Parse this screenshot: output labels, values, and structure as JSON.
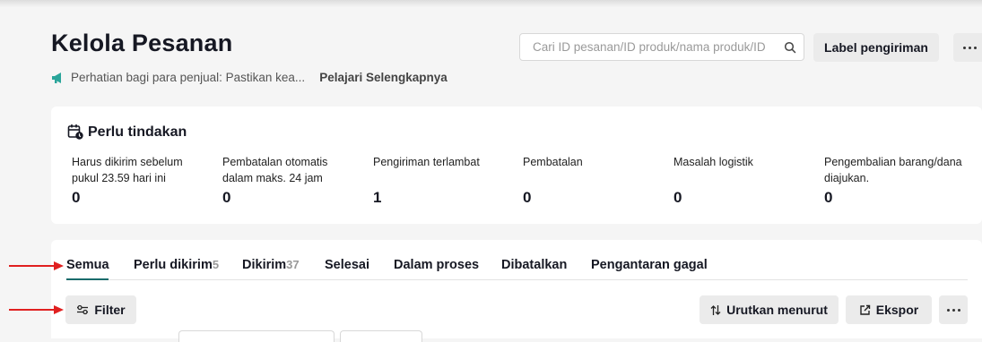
{
  "header": {
    "title": "Kelola Pesanan",
    "notice_text": "Perhatian bagi para penjual: Pastikan kea...",
    "notice_link": "Pelajari Selengkapnya",
    "search_placeholder": "Cari ID pesanan/ID produk/nama produk/ID",
    "shipping_label_button": "Label pengiriman"
  },
  "action_card": {
    "title": "Perlu tindakan",
    "items": [
      {
        "label": "Harus dikirim sebelum pukul 23.59 hari ini",
        "value": "0"
      },
      {
        "label": "Pembatalan otomatis dalam maks. 24 jam",
        "value": "0"
      },
      {
        "label": "Pengiriman terlambat",
        "value": "1"
      },
      {
        "label": "Pembatalan",
        "value": "0"
      },
      {
        "label": "Masalah logistik",
        "value": "0"
      },
      {
        "label": "Pengembalian barang/dana diajukan.",
        "value": "0"
      }
    ]
  },
  "tabs": [
    {
      "label": "Semua",
      "count": ""
    },
    {
      "label": "Perlu dikirim",
      "count": "5"
    },
    {
      "label": "Dikirim",
      "count": "37"
    },
    {
      "label": "Selesai",
      "count": ""
    },
    {
      "label": "Dalam proses",
      "count": ""
    },
    {
      "label": "Dibatalkan",
      "count": ""
    },
    {
      "label": "Pengantaran gagal",
      "count": ""
    }
  ],
  "toolbar": {
    "filter": "Filter",
    "sort": "Urutkan menurut",
    "export": "Ekspor"
  },
  "icons": {
    "notice": "megaphone-icon",
    "card": "calendar-clock-icon",
    "search": "search-icon",
    "filter": "filter-sliders-icon",
    "sort": "sort-arrows-icon",
    "export": "external-link-icon",
    "more": "more-horizontal-icon"
  },
  "colors": {
    "accent": "#1a6b6b",
    "notice_icon": "#2aa59a",
    "annotation_arrow": "#e02020"
  }
}
